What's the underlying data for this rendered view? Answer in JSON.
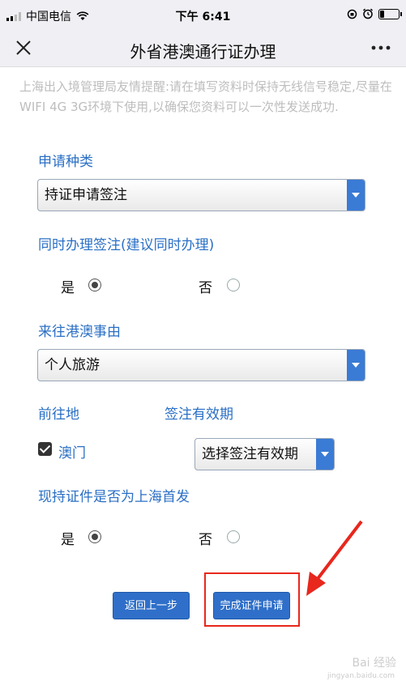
{
  "status_bar": {
    "carrier": "中国电信",
    "time": "下午 6:41"
  },
  "nav": {
    "title": "外省港澳通行证办理"
  },
  "notice": "上海出入境管理局友情提醒:请在填写资料时保持无线信号稳定,尽量在WIFI 4G 3G环境下使用,以确保您资料可以一次性发送成功.",
  "form": {
    "apply_type": {
      "label": "申请种类",
      "value": "持证申请签注"
    },
    "simultaneous": {
      "label": "同时办理签注(建议同时办理)",
      "yes_label": "是",
      "no_label": "否",
      "selected": "是"
    },
    "reason": {
      "label": "来往港澳事由",
      "value": "个人旅游"
    },
    "destination": {
      "label": "前往地",
      "option_label": "澳门",
      "checked": true
    },
    "validity": {
      "label": "签注有效期",
      "value": "选择签注有效期"
    },
    "first_issue": {
      "label": "现持证件是否为上海首发",
      "yes_label": "是",
      "no_label": "否",
      "selected": "是"
    }
  },
  "buttons": {
    "back": "返回上一步",
    "submit": "完成证件申请"
  },
  "watermark": {
    "brand": "Bai 经验",
    "url": "jingyan.baidu.com"
  },
  "colors": {
    "accent": "#2a6fc5",
    "button": "#2f6fc9",
    "highlight": "#e8271d"
  }
}
